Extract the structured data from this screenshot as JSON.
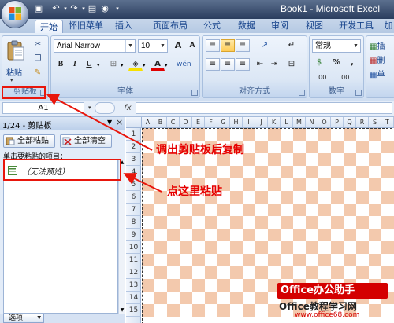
{
  "window": {
    "title": "Book1 - Microsoft Excel"
  },
  "tabs": [
    "开始",
    "怀旧菜单",
    "插入",
    "页面布局",
    "公式",
    "数据",
    "审阅",
    "视图",
    "开发工具",
    "加"
  ],
  "ribbon": {
    "paste_label": "粘贴",
    "font_name": "Arial Narrow",
    "font_size": "10",
    "grow_font": "A",
    "shrink_font": "A",
    "bold": "B",
    "italic": "I",
    "underline": "U",
    "number_format": "常规",
    "percent": "%",
    "comma": ",",
    "inc_decimal": ".00",
    "dec_decimal": ".00",
    "cells_items": [
      "插",
      "删",
      "单"
    ],
    "groups": {
      "clipboard": "剪贴板",
      "font": "字体",
      "alignment": "对齐方式",
      "number": "数字"
    }
  },
  "formula_bar": {
    "name_box": "A1",
    "fx": "fx"
  },
  "clipboard_pane": {
    "title": "1/24 - 剪贴板",
    "paste_all": "全部粘贴",
    "clear_all": "全部清空",
    "hint": "单击要粘贴的项目：",
    "item": "（无法预览）",
    "options": "选项"
  },
  "grid": {
    "columns": [
      "A",
      "B",
      "C",
      "D",
      "E",
      "F",
      "G",
      "H",
      "I",
      "J",
      "K",
      "L",
      "M",
      "N",
      "O",
      "P",
      "Q",
      "R",
      "S",
      "T"
    ],
    "rows": [
      "1",
      "2",
      "3",
      "4",
      "5",
      "6",
      "7",
      "8",
      "9",
      "10",
      "11",
      "12",
      "13",
      "14",
      "15"
    ]
  },
  "annotations": {
    "copy_note": "调出剪贴板后复制",
    "paste_note": "点这里粘贴"
  },
  "watermark": {
    "brand": "Office办公助手",
    "line2": "Office教程学习网",
    "url": "www.office68.com"
  },
  "colors": {
    "annotation": "#e60000",
    "checker": "#f3c9ad",
    "ribbon": "#dce7f5"
  }
}
